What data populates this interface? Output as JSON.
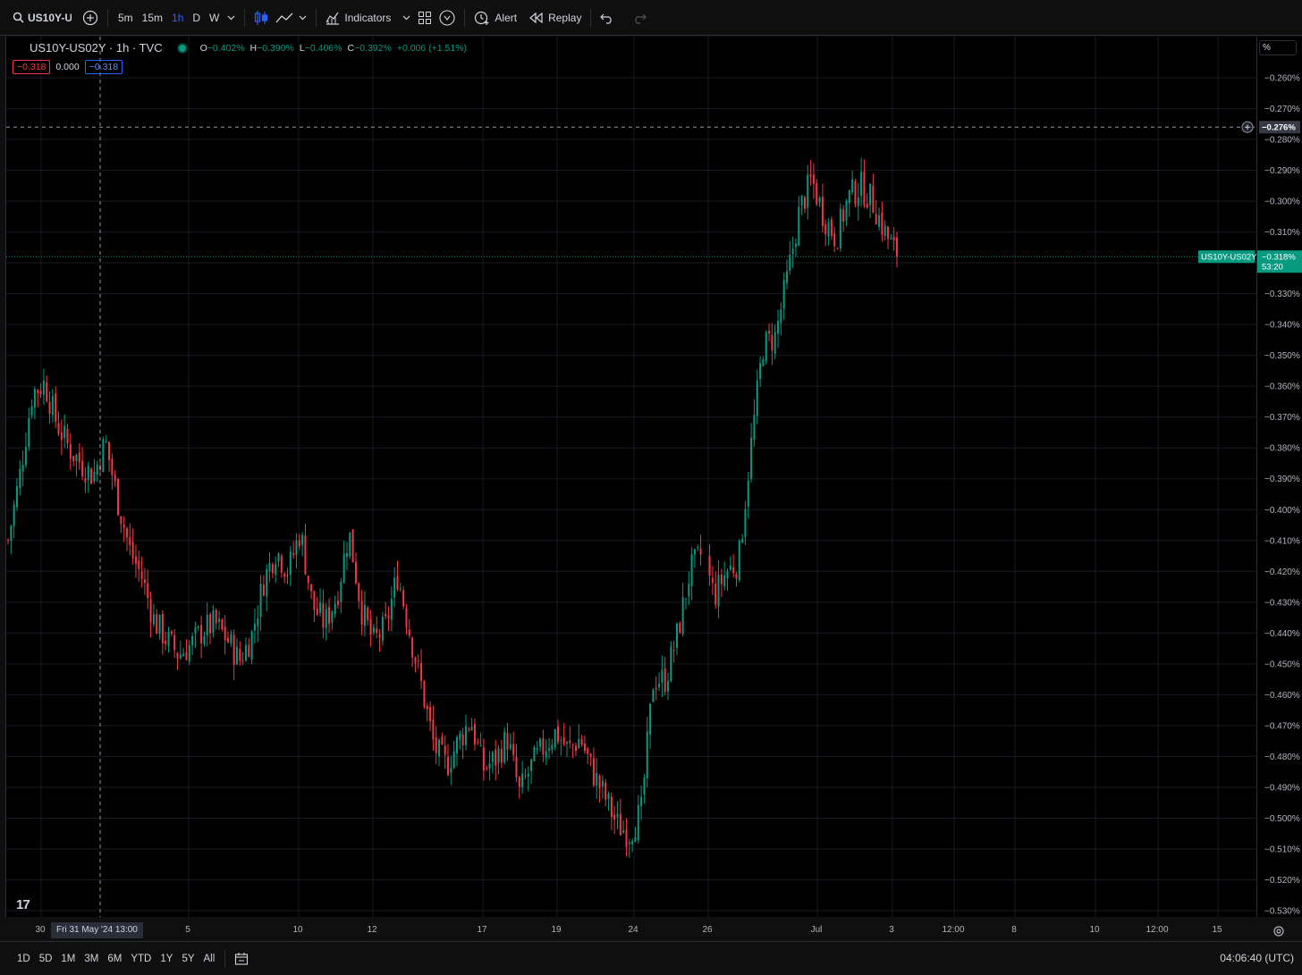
{
  "toolbar": {
    "symbol": "US10Y-US",
    "intervals": [
      "5m",
      "15m",
      "1h",
      "D",
      "W"
    ],
    "active_interval": "1h",
    "indicators_label": "Indicators",
    "alert_label": "Alert",
    "replay_label": "Replay",
    "icons": [
      "search-icon",
      "add-symbol-icon",
      "candles-icon",
      "line-chart-icon",
      "indicators-icon",
      "layouts-icon",
      "templates-icon",
      "alert-icon",
      "replay-icon",
      "undo-icon",
      "redo-icon"
    ]
  },
  "legend": {
    "title": "US10Y-US02Y · 1h · TVC",
    "o_label": "O",
    "o_value": "−0.402%",
    "h_label": "H",
    "h_value": "−0.390%",
    "l_label": "L",
    "l_value": "−0.406%",
    "c_label": "C",
    "c_value": "−0.392%",
    "change": "+0.006 (+1.51%)",
    "indicator_values": [
      "−0.318",
      "0.000",
      "−0.318"
    ]
  },
  "price_axis": {
    "unit_button": "%",
    "crosshair_price": "−0.276%",
    "last_price_label": "US10Y-US02Y",
    "last_price": "−0.318%",
    "countdown": "53:20"
  },
  "time_axis": {
    "crosshair_time": "Fri 31 May '24   13:00"
  },
  "ranges": [
    "1D",
    "5D",
    "1M",
    "3M",
    "6M",
    "YTD",
    "1Y",
    "5Y",
    "All"
  ],
  "clock": "04:06:40 (UTC)",
  "colors": {
    "up": "#089981",
    "down": "#f23645",
    "background": "#000000",
    "accent": "#2962ff"
  },
  "chart_data": {
    "type": "candlestick",
    "title": "US10Y-US02Y · 1h · TVC",
    "ylim": [
      -0.533,
      -0.254
    ],
    "y_ticks": [
      "-0.260%",
      "-0.270%",
      "-0.280%",
      "-0.290%",
      "-0.300%",
      "-0.310%",
      "-0.320%",
      "-0.330%",
      "-0.340%",
      "-0.350%",
      "-0.360%",
      "-0.370%",
      "-0.380%",
      "-0.390%",
      "-0.400%",
      "-0.410%",
      "-0.420%",
      "-0.430%",
      "-0.440%",
      "-0.450%",
      "-0.460%",
      "-0.470%",
      "-0.480%",
      "-0.490%",
      "-0.500%",
      "-0.510%",
      "-0.520%",
      "-0.530%"
    ],
    "x_ticks": [
      "30",
      "5",
      "10",
      "12",
      "17",
      "19",
      "24",
      "26",
      "Jul",
      "3",
      "12:00",
      "8",
      "10",
      "12:00",
      "15"
    ],
    "price_path": [
      [
        "May 29",
        -0.41
      ],
      [
        "May 29",
        -0.388
      ],
      [
        "May 30",
        -0.362
      ],
      [
        "May 30",
        -0.359
      ],
      [
        "May 30",
        -0.372
      ],
      [
        "May 31",
        -0.38
      ],
      [
        "May 31",
        -0.385
      ],
      [
        "May 31",
        -0.389
      ],
      [
        "May 31",
        -0.378
      ],
      [
        "Jun 3",
        -0.397
      ],
      [
        "Jun 3",
        -0.413
      ],
      [
        "Jun 4",
        -0.422
      ],
      [
        "Jun 4",
        -0.436
      ],
      [
        "Jun 5",
        -0.442
      ],
      [
        "Jun 5",
        -0.447
      ],
      [
        "Jun 6",
        -0.444
      ],
      [
        "Jun 6",
        -0.439
      ],
      [
        "Jun 7",
        -0.437
      ],
      [
        "Jun 7",
        -0.442
      ],
      [
        "Jun 10",
        -0.449
      ],
      [
        "Jun 10",
        -0.441
      ],
      [
        "Jun 11",
        -0.423
      ],
      [
        "Jun 11",
        -0.413
      ],
      [
        "Jun 11",
        -0.42
      ],
      [
        "Jun 12",
        -0.407
      ],
      [
        "Jun 12",
        -0.431
      ],
      [
        "Jun 13",
        -0.437
      ],
      [
        "Jun 13",
        -0.428
      ],
      [
        "Jun 13",
        -0.407
      ],
      [
        "Jun 14",
        -0.432
      ],
      [
        "Jun 14",
        -0.443
      ],
      [
        "Jun 14",
        -0.438
      ],
      [
        "Jun 17",
        -0.421
      ],
      [
        "Jun 17",
        -0.44
      ],
      [
        "Jun 18",
        -0.458
      ],
      [
        "Jun 18",
        -0.477
      ],
      [
        "Jun 18",
        -0.483
      ],
      [
        "Jun 19",
        -0.475
      ],
      [
        "Jun 19",
        -0.468
      ],
      [
        "Jun 20",
        -0.484
      ],
      [
        "Jun 20",
        -0.481
      ],
      [
        "Jun 20",
        -0.474
      ],
      [
        "Jun 21",
        -0.492
      ],
      [
        "Jun 21",
        -0.483
      ],
      [
        "Jun 21",
        -0.477
      ],
      [
        "Jun 24",
        -0.472
      ],
      [
        "Jun 24",
        -0.478
      ],
      [
        "Jun 24",
        -0.474
      ],
      [
        "Jun 25",
        -0.485
      ],
      [
        "Jun 25",
        -0.493
      ],
      [
        "Jun 25",
        -0.502
      ],
      [
        "Jun 25",
        -0.505
      ],
      [
        "Jun 26",
        -0.498
      ],
      [
        "Jun 26",
        -0.455
      ],
      [
        "Jun 26",
        -0.455
      ],
      [
        "Jun 27",
        -0.44
      ],
      [
        "Jun 27",
        -0.42
      ],
      [
        "Jun 27",
        -0.414
      ],
      [
        "Jun 28",
        -0.428
      ],
      [
        "Jun 28",
        -0.42
      ],
      [
        "Jun 28",
        -0.417
      ],
      [
        "Jul 1",
        -0.38
      ],
      [
        "Jul 1",
        -0.347
      ],
      [
        "Jul 1",
        -0.344
      ],
      [
        "Jul 1",
        -0.325
      ],
      [
        "Jul 1",
        -0.303
      ],
      [
        "Jul 2",
        -0.293
      ],
      [
        "Jul 2",
        -0.305
      ],
      [
        "Jul 2",
        -0.312
      ],
      [
        "Jul 2",
        -0.299
      ],
      [
        "Jul 2",
        -0.295
      ],
      [
        "Jul 2",
        -0.3
      ],
      [
        "Jul 3",
        -0.31
      ],
      [
        "Jul 3",
        -0.318
      ]
    ],
    "last_value": -0.318,
    "high_marker": -0.276
  }
}
